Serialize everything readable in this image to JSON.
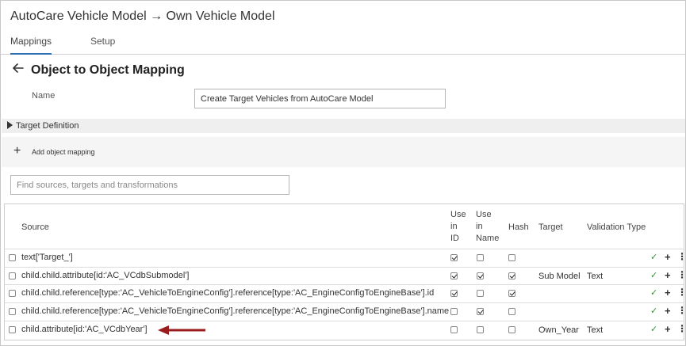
{
  "app": {
    "title": "AutoCare Vehicle Model → Own Vehicle Model"
  },
  "tabs": [
    {
      "label": "Mappings",
      "active": true
    },
    {
      "label": "Setup",
      "active": false
    }
  ],
  "page": {
    "title": "Object to Object Mapping"
  },
  "form": {
    "name_label": "Name",
    "name_value": "Create Target Vehicles from AutoCare Model"
  },
  "sections": {
    "target_definition": "Target Definition",
    "add_mapping": "Add object mapping"
  },
  "search": {
    "placeholder": "Find sources, targets and transformations"
  },
  "grid": {
    "headers": {
      "source": "Source",
      "use_in_id": "Use\nin\nID",
      "use_in_name": "Use\nin\nName",
      "hash": "Hash",
      "target": "Target",
      "validation_type": "Validation Type"
    },
    "rows": [
      {
        "source": "text['Target_']",
        "use_in_id": true,
        "use_in_name": false,
        "hash": false,
        "target": "",
        "validation_type": ""
      },
      {
        "source": "child.child.attribute[id:'AC_VCdbSubmodel']",
        "use_in_id": true,
        "use_in_name": true,
        "hash": true,
        "target": "Sub Model",
        "validation_type": "Text"
      },
      {
        "source": "child.child.reference[type:'AC_VehicleToEngineConfig'].reference[type:'AC_EngineConfigToEngineBase'].id",
        "use_in_id": true,
        "use_in_name": false,
        "hash": true,
        "target": "",
        "validation_type": ""
      },
      {
        "source": "child.child.reference[type:'AC_VehicleToEngineConfig'].reference[type:'AC_EngineConfigToEngineBase'].name",
        "use_in_id": false,
        "use_in_name": true,
        "hash": false,
        "target": "",
        "validation_type": ""
      },
      {
        "source": "child.attribute[id:'AC_VCdbYear']",
        "use_in_id": false,
        "use_in_name": false,
        "hash": false,
        "target": "Own_Year",
        "validation_type": "Text"
      }
    ],
    "row_actions": {
      "ok": "✓",
      "add": "+",
      "more": "⋮"
    }
  },
  "colors": {
    "accent": "#2f6db5",
    "ok_green": "#3a8d3a",
    "annotation_arrow": "#9b1c1c"
  }
}
